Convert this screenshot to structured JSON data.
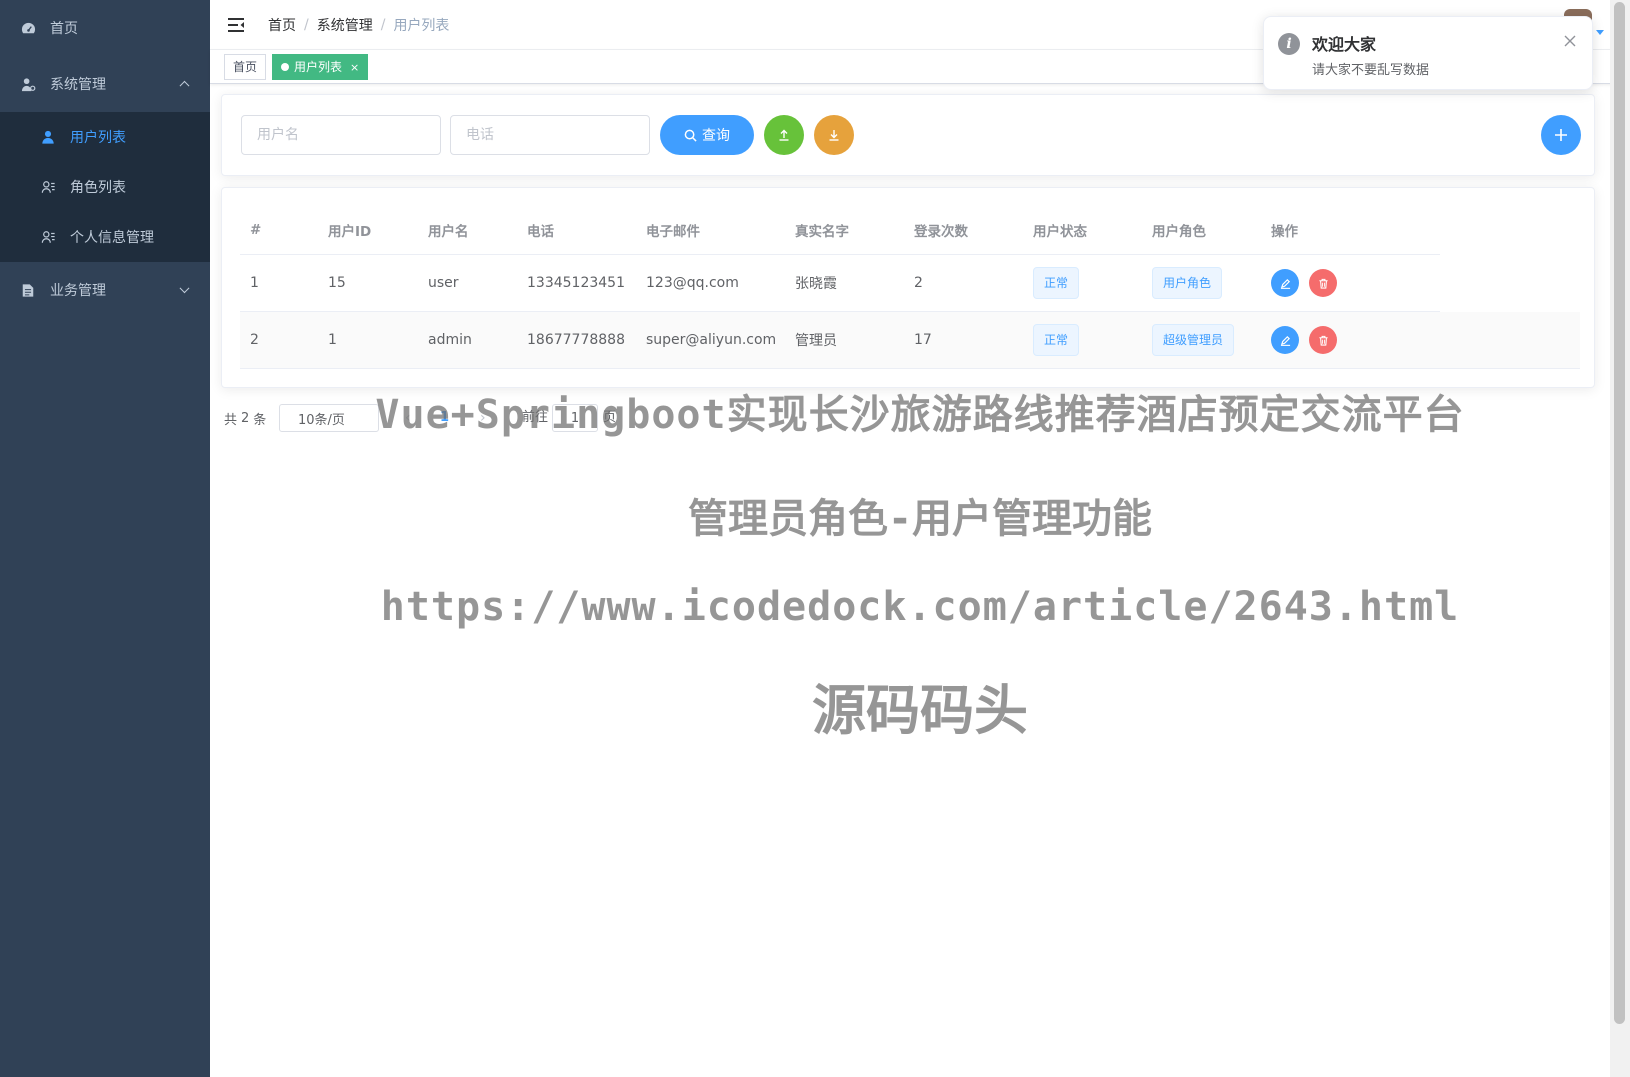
{
  "sidebar": {
    "items": [
      {
        "label": "首页",
        "icon": "dashboard-icon"
      },
      {
        "label": "系统管理",
        "icon": "user-gear-icon",
        "expanded": true
      },
      {
        "label": "业务管理",
        "icon": "document-icon",
        "expanded": false
      }
    ],
    "submenu": [
      {
        "label": "用户列表",
        "icon": "user-icon",
        "active": true
      },
      {
        "label": "角色列表",
        "icon": "user-list-icon"
      },
      {
        "label": "个人信息管理",
        "icon": "user-list-icon"
      }
    ],
    "bg_color": "#304156",
    "active_color": "#409eff"
  },
  "navbar": {
    "breadcrumb": [
      "首页",
      "系统管理",
      "用户列表"
    ],
    "separator": "/"
  },
  "tags": {
    "home": "首页",
    "active": "用户列表",
    "close": "×",
    "active_color": "#42b983"
  },
  "search": {
    "username_placeholder": "用户名",
    "phone_placeholder": "电话",
    "query_label": "查询",
    "upload_color": "#67c23a",
    "download_color": "#e6a23c",
    "add_color": "#409eff"
  },
  "table": {
    "columns": [
      "#",
      "用户ID",
      "用户名",
      "电话",
      "电子邮件",
      "真实名字",
      "登录次数",
      "用户状态",
      "用户角色",
      "操作"
    ],
    "rows": [
      {
        "index": "1",
        "id": "15",
        "username": "user",
        "phone": "13345123451",
        "email": "123@qq.com",
        "realname": "张晓霞",
        "logins": "2",
        "status": "正常",
        "role": "用户角色"
      },
      {
        "index": "2",
        "id": "1",
        "username": "admin",
        "phone": "18677778888",
        "email": "super@aliyun.com",
        "realname": "管理员",
        "logins": "17",
        "status": "正常",
        "role": "超级管理员"
      }
    ]
  },
  "pagination": {
    "total_prefix": "共",
    "total": "2",
    "total_suffix": "条",
    "page_size": "10条/页",
    "current": "1",
    "goto_label": "前往",
    "goto_value": "1",
    "page_suffix": "页"
  },
  "watermark": {
    "line1": "Vue+Springboot实现长沙旅游路线推荐酒店预定交流平台",
    "line2": "管理员角色-用户管理功能",
    "line3": "https://www.icodedock.com/article/2643.html",
    "line4": "源码码头"
  },
  "notification": {
    "title": "欢迎大家",
    "message": "请大家不要乱写数据"
  }
}
